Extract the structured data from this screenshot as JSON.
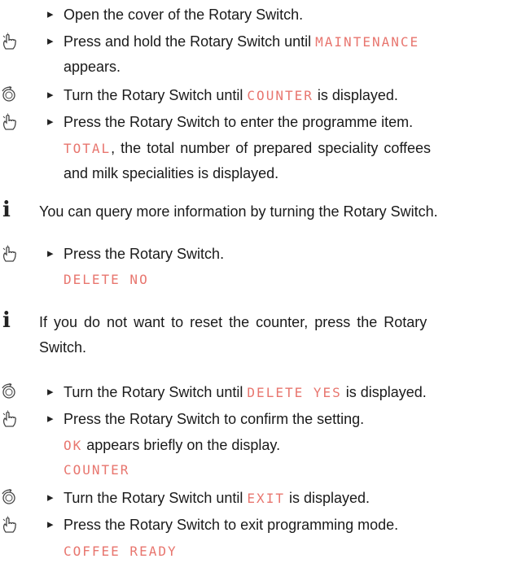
{
  "steps": {
    "s1": {
      "text": "Open the cover of the Rotary Switch."
    },
    "s2": {
      "pre": "Press and hold the Rotary Switch until ",
      "disp": "MAINTENANCE",
      "cont": "appears."
    },
    "s3": {
      "pre": "Turn the Rotary Switch until ",
      "disp": "COUNTER",
      "post": " is displayed."
    },
    "s4": {
      "text": "Press the Rotary Switch to enter the programme item.",
      "disp": "TOTAL",
      "cont1": ", the total number of prepared speciality coffees",
      "cont2": "and milk specialities is displayed."
    },
    "note1": "You can query more information by turning the Rotary Switch.",
    "s5": {
      "text": "Press the Rotary Switch.",
      "disp": "DELETE NO"
    },
    "note2": {
      "line1": "If you do not want to reset the counter, press the Rotary",
      "line2": "Switch."
    },
    "s6": {
      "pre": "Turn the Rotary Switch until ",
      "disp": "DELETE YES",
      "post": " is displayed."
    },
    "s7": {
      "text": "Press the Rotary Switch to confirm the setting.",
      "disp_ok": "OK",
      "ok_text": " appears briefly on the display.",
      "disp2": "COUNTER"
    },
    "s8": {
      "pre": "Turn the Rotary Switch until ",
      "disp": "EXIT",
      "post": " is displayed."
    },
    "s9": {
      "text": "Press the Rotary Switch to exit programming mode.",
      "disp": "COFFEE READY"
    }
  },
  "icons": {
    "press": "press-rotary-switch-icon",
    "turn": "turn-rotary-switch-icon",
    "info": "i"
  },
  "colors": {
    "display_text": "#e8766f",
    "body_text": "#1a1a1a"
  }
}
